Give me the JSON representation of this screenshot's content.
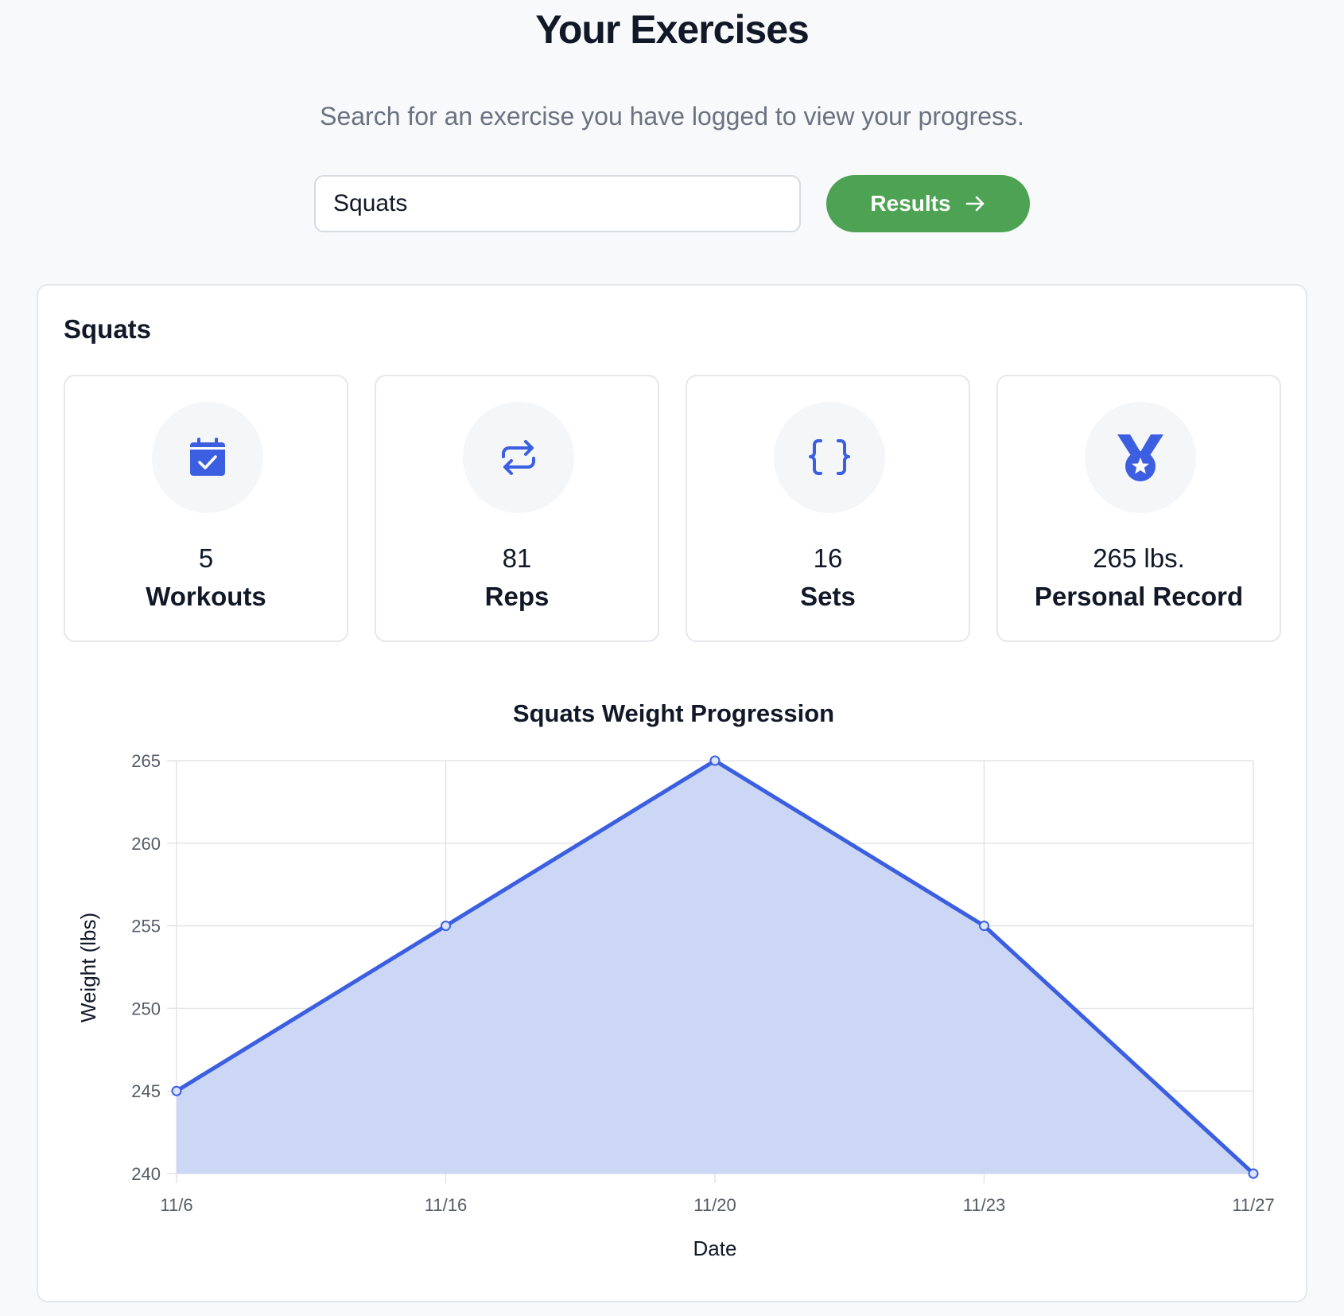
{
  "header": {
    "title": "Your Exercises",
    "subtitle": "Search for an exercise you have logged to view your progress."
  },
  "search": {
    "value": "Squats",
    "button_label": "Results",
    "button_icon": "arrow-right-icon"
  },
  "card": {
    "title": "Squats",
    "stats": [
      {
        "value": "5",
        "label": "Workouts",
        "icon": "calendar-check-icon"
      },
      {
        "value": "81",
        "label": "Reps",
        "icon": "repeat-icon"
      },
      {
        "value": "16",
        "label": "Sets",
        "icon": "braces-icon"
      },
      {
        "value": "265 lbs.",
        "label": "Personal Record",
        "icon": "medal-icon"
      }
    ]
  },
  "colors": {
    "accent": "#3b5fe0",
    "button": "#4da353",
    "area_fill": "#c9d5f5"
  },
  "chart_data": {
    "type": "area",
    "title": "Squats Weight Progression",
    "xlabel": "Date",
    "ylabel": "Weight (lbs)",
    "categories": [
      "11/6",
      "11/16",
      "11/20",
      "11/23",
      "11/27"
    ],
    "series": [
      {
        "values": [
          245,
          255,
          265,
          255,
          240
        ]
      }
    ],
    "ylim": [
      240,
      265
    ],
    "yticks": [
      240,
      245,
      250,
      255,
      260,
      265
    ],
    "grid": true,
    "legend": "none"
  }
}
